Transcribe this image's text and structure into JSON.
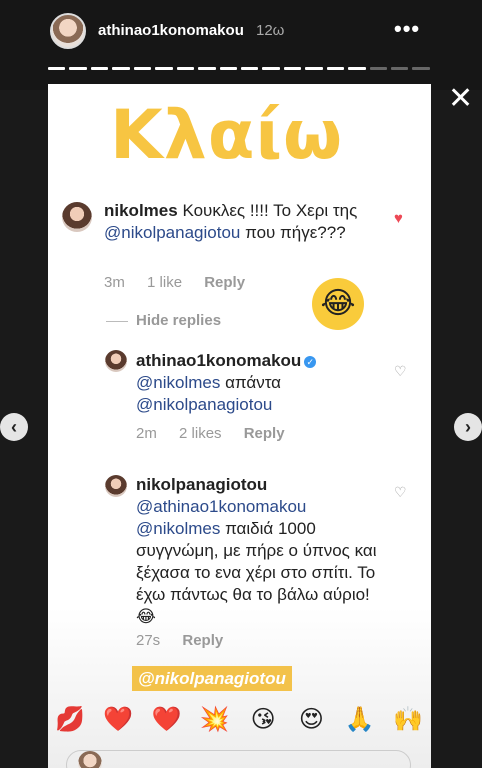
{
  "header": {
    "username": "athinao1konomakou",
    "time": "12ω",
    "more": "•••"
  },
  "story": {
    "headline": "Κλαίω",
    "comments": [
      {
        "user": "nikolmes",
        "text_pre": "Κουκλες !!!! Το Χερι της ",
        "mention": "@nikolpanagiotou",
        "text_post": " που πήγε???",
        "time": "3m",
        "likes": "1 like",
        "reply": "Reply"
      },
      {
        "user": "athinao1konomakou",
        "verified": "✓",
        "mention1": "@nikolmes",
        "text_mid": " απάντα ",
        "mention2": "@nikolpanagiotou",
        "time": "2m",
        "likes": "2 likes",
        "reply": "Reply"
      },
      {
        "user": "nikolpanagiotou",
        "mention1": "@athinao1konomakou",
        "mention2": "@nikolmes",
        "text": " παιδιά 1000 συγγνώμη, με πήρε ο ύπνος και ξέχασα το ενα χέρι στο σπίτι. Το έχω πάντως θα το βάλω αύριο!😂",
        "time": "27s",
        "reply": "Reply"
      }
    ],
    "hide_replies": "Hide replies",
    "tag_sticker": "@nikolpanagiotou"
  },
  "icons": {
    "close": "close-icon",
    "nav_prev": "chevron-left-icon",
    "nav_next": "chevron-right-icon",
    "heart_filled": "heart-filled-icon",
    "heart_outline": "heart-outline-icon"
  },
  "colors": {
    "headline": "#f7c542",
    "mention": "#2c4a8a",
    "heart": "#ed4956",
    "verified": "#3897f0"
  },
  "reactions": [
    "💋",
    "❤️",
    "❤️",
    "💥",
    "😘",
    "😍",
    "🙏",
    "🙌"
  ]
}
